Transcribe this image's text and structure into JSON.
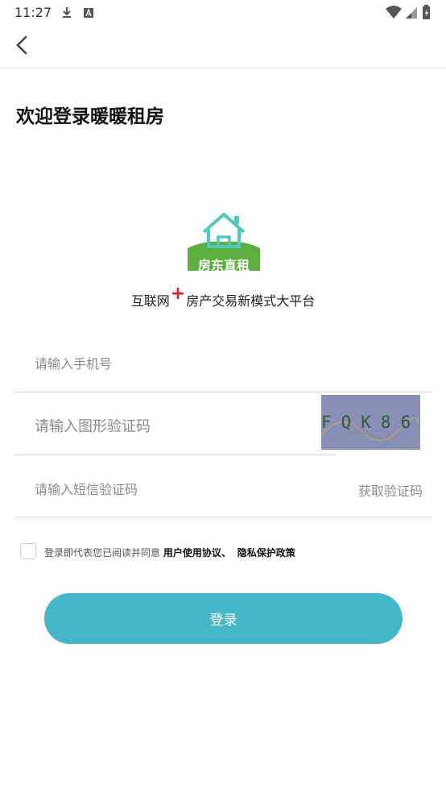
{
  "status": {
    "time": "11:27",
    "icons": [
      "download-icon",
      "text-a-icon",
      "wifi-icon",
      "signal-icon",
      "battery-icon"
    ]
  },
  "nav": {
    "back_icon": "chevron-left-icon"
  },
  "page": {
    "title": "欢迎登录暖暖租房"
  },
  "logo": {
    "text": "房东直租",
    "icon": "house-icon"
  },
  "slogan": {
    "part1": "互联网",
    "plus": "+",
    "part2": "房产交易新模式大平台"
  },
  "form": {
    "phone_placeholder": "请输入手机号",
    "captcha_placeholder": "请输入图形验证码",
    "captcha_text": "FQK86",
    "sms_placeholder": "请输入短信验证码",
    "get_code_label": "获取验证码"
  },
  "agreement": {
    "prefix": "登录即代表您已阅读并同意",
    "user_agreement": "用户使用协议、",
    "privacy_policy": "隐私保护政策",
    "checked": false
  },
  "login_button": "登录",
  "colors": {
    "accent": "#45b7cb",
    "logo_green": "#5cae3e",
    "plus_red": "#e0211b"
  }
}
